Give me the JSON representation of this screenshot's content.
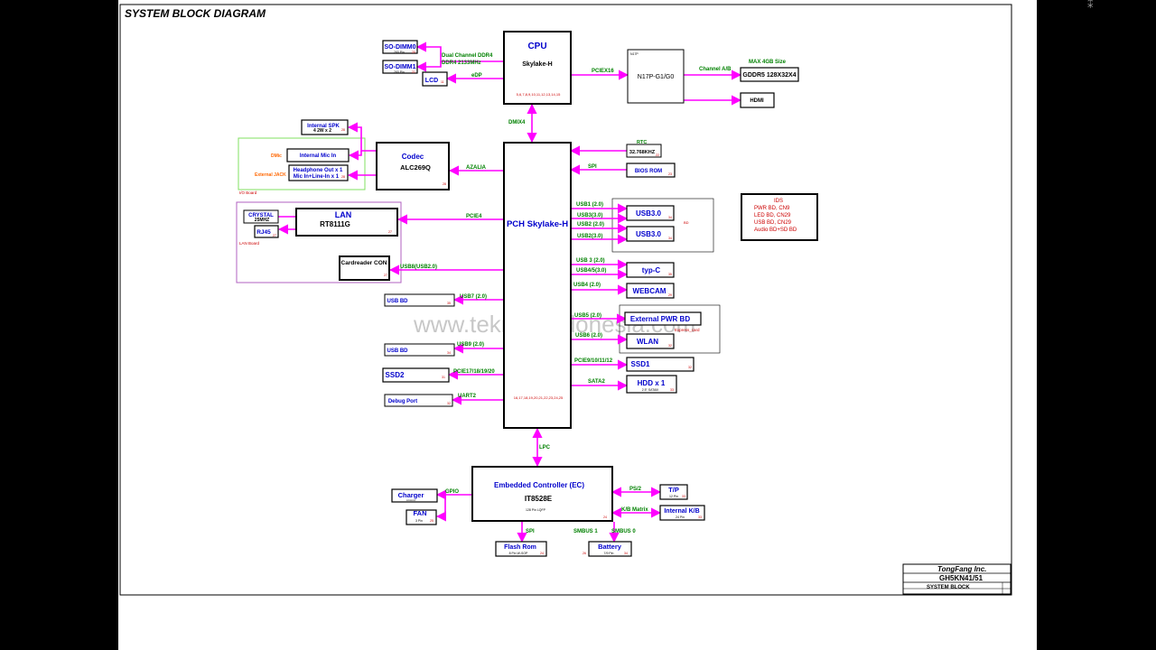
{
  "title": "SYSTEM BLOCK DIAGRAM",
  "watermark": "www.teknisi-indonesia.com",
  "viewer": {
    "close_icon": "close-icon"
  },
  "colors": {
    "link": "#ff00ff",
    "box": "#000000",
    "blue_text": "#0000cc",
    "green_text": "#008000",
    "red_text": "#cc0000",
    "orange_text": "#ff6600"
  },
  "blocks": {
    "so_dimm0": {
      "name": "SO-DIMM0",
      "sub": "260 Pin",
      "page": "20"
    },
    "so_dimm1": {
      "name": "SO-DIMM1",
      "sub": "260 Pin",
      "page": "21"
    },
    "lcd": {
      "name": "LCD",
      "page": "11"
    },
    "cpu": {
      "name": "CPU",
      "model": "Skylake-H",
      "pages": "5,6,7,8,9,10,11,12,13,14,15"
    },
    "gpu": {
      "tag": "N17P",
      "name": "N17P-G1/G0"
    },
    "gddr5": {
      "name": "GDDR5 128X32X4"
    },
    "hdmi": {
      "name": "HDMI"
    },
    "speaker": {
      "name": "Internal SPK",
      "sub": "4   2W x 2",
      "page": "28"
    },
    "int_mic": {
      "name": "Internal Mic In"
    },
    "headphone": {
      "line1": "Headphone Out x 1",
      "line2": "Mic In+Line-In x 1",
      "page": "28"
    },
    "codec": {
      "name": "Codec",
      "model": "ALC269Q",
      "page": "28"
    },
    "rtc": {
      "name": "32.768KHZ",
      "page": "22"
    },
    "bios": {
      "name": "BIOS ROM",
      "page": "23"
    },
    "crystal": {
      "name": "CRYSTAL",
      "freq": "25MHZ"
    },
    "rj45": {
      "name": "RJ45",
      "page": "27"
    },
    "lan": {
      "name": "LAN",
      "model": "RT8111G",
      "page": "27"
    },
    "cardreader": {
      "name": "Cardreader CON",
      "page": "27"
    },
    "pch": {
      "name": "PCH Skylake-H",
      "pages": "16,17,18,19,20,21,22,23,24,25"
    },
    "usb30a": {
      "name": "USB3.0",
      "page": "34"
    },
    "usb30b": {
      "name": "USB3.0",
      "page": "34"
    },
    "typc": {
      "name": "typ-C",
      "page": "35"
    },
    "webcam": {
      "name": "WEBCAM",
      "page": "29"
    },
    "ext_pwr": {
      "name": "External PWR BD"
    },
    "wlan": {
      "name": "WLAN",
      "page": "32"
    },
    "ssd1": {
      "name": "SSD1",
      "page": "32"
    },
    "hdd": {
      "name": "HDD x 1",
      "sub": "2.5\" SATAIII",
      "page": "33"
    },
    "usb_bd1": {
      "name": "USB BD",
      "page": "35"
    },
    "usb_bd2": {
      "name": "USB BD",
      "page": "34"
    },
    "ssd2": {
      "name": "SSD2",
      "page": "31"
    },
    "debug": {
      "name": "Debug Port",
      "page": "32"
    },
    "ec": {
      "name": "Embedded Controller (EC)",
      "model": "IT8528E",
      "sub": "128 Pin LQFP",
      "page": "24"
    },
    "charger": {
      "name": "Charger",
      "sub": "xxxxxxxx"
    },
    "fan": {
      "name": "FAN",
      "sub": "3 Pin",
      "page": "25"
    },
    "tp": {
      "name": "T/P",
      "sub": "12 Pin",
      "page": "33"
    },
    "int_kb": {
      "name": "Internal K/B",
      "sub": "24 Pin",
      "page": "33"
    },
    "flash": {
      "name": "Flash Rom",
      "sub": "8 Pin W-SOP",
      "page": "24"
    },
    "battery": {
      "name": "Battery",
      "sub": "7/9 Pin",
      "page_l": "26",
      "page_r": "34"
    }
  },
  "ids_box": {
    "lines": [
      "IDS",
      "PWR BD, CN9",
      "LED BD, CN29",
      "USB BD, CN29",
      "Audio BD+SD BD"
    ]
  },
  "labels": {
    "dual_channel": "Dual Channel DDR4",
    "ddr4": "DDR4 2133MHz",
    "edp": "eDP",
    "pciex16": "PCIEX16",
    "channel_ab": "Channel A/B",
    "max_4gb": "MAX 4GB Size",
    "dmix4": "DMIX4",
    "rtc": "RTC",
    "spi_bios": "SPI",
    "azalia": "AZALIA",
    "dmic": "DMic",
    "ext_jack": "External JACK",
    "io_board": "I/O Board",
    "pcie4": "PCIE4",
    "lan_board": "LAN Board",
    "usb8": "USB8(USB2.0)",
    "usb1": "USB1  (2.0)",
    "usb3_30": "USB3(3.0)",
    "usb2_20": "USB2  (2.0)",
    "usb2_30": "USB2(3.0)",
    "usb_bd_tag": "BD",
    "usb3_20": "USB 3   (2.0)",
    "usb45": "USB4/5(3.0)",
    "usb4_20": "USB4 (2.0)",
    "usb5": "USB5 (2.0)",
    "usb6": "USB6 (2.0)",
    "express_card": "Express_card",
    "pcie9": "PCIE9/10/11/12",
    "sata2": "SATA2",
    "usb7": "USB7  (2.0)",
    "usb9": "USB9 (2.0)",
    "pcie17": "PCIE17/18/19/20",
    "uart2": "UART2",
    "lpc": "LPC",
    "gpio": "GPIO",
    "ps2": "PS/2",
    "kb_matrix": "K/B Matrix",
    "spi_flash": "SPI",
    "smbus1": "SMBUS 1",
    "smbus0": "SMBUS 0"
  },
  "title_block": {
    "company": "TongFang Inc.",
    "model": "GH5KN41/51",
    "sheet": "SYSTEM BLOCK"
  }
}
